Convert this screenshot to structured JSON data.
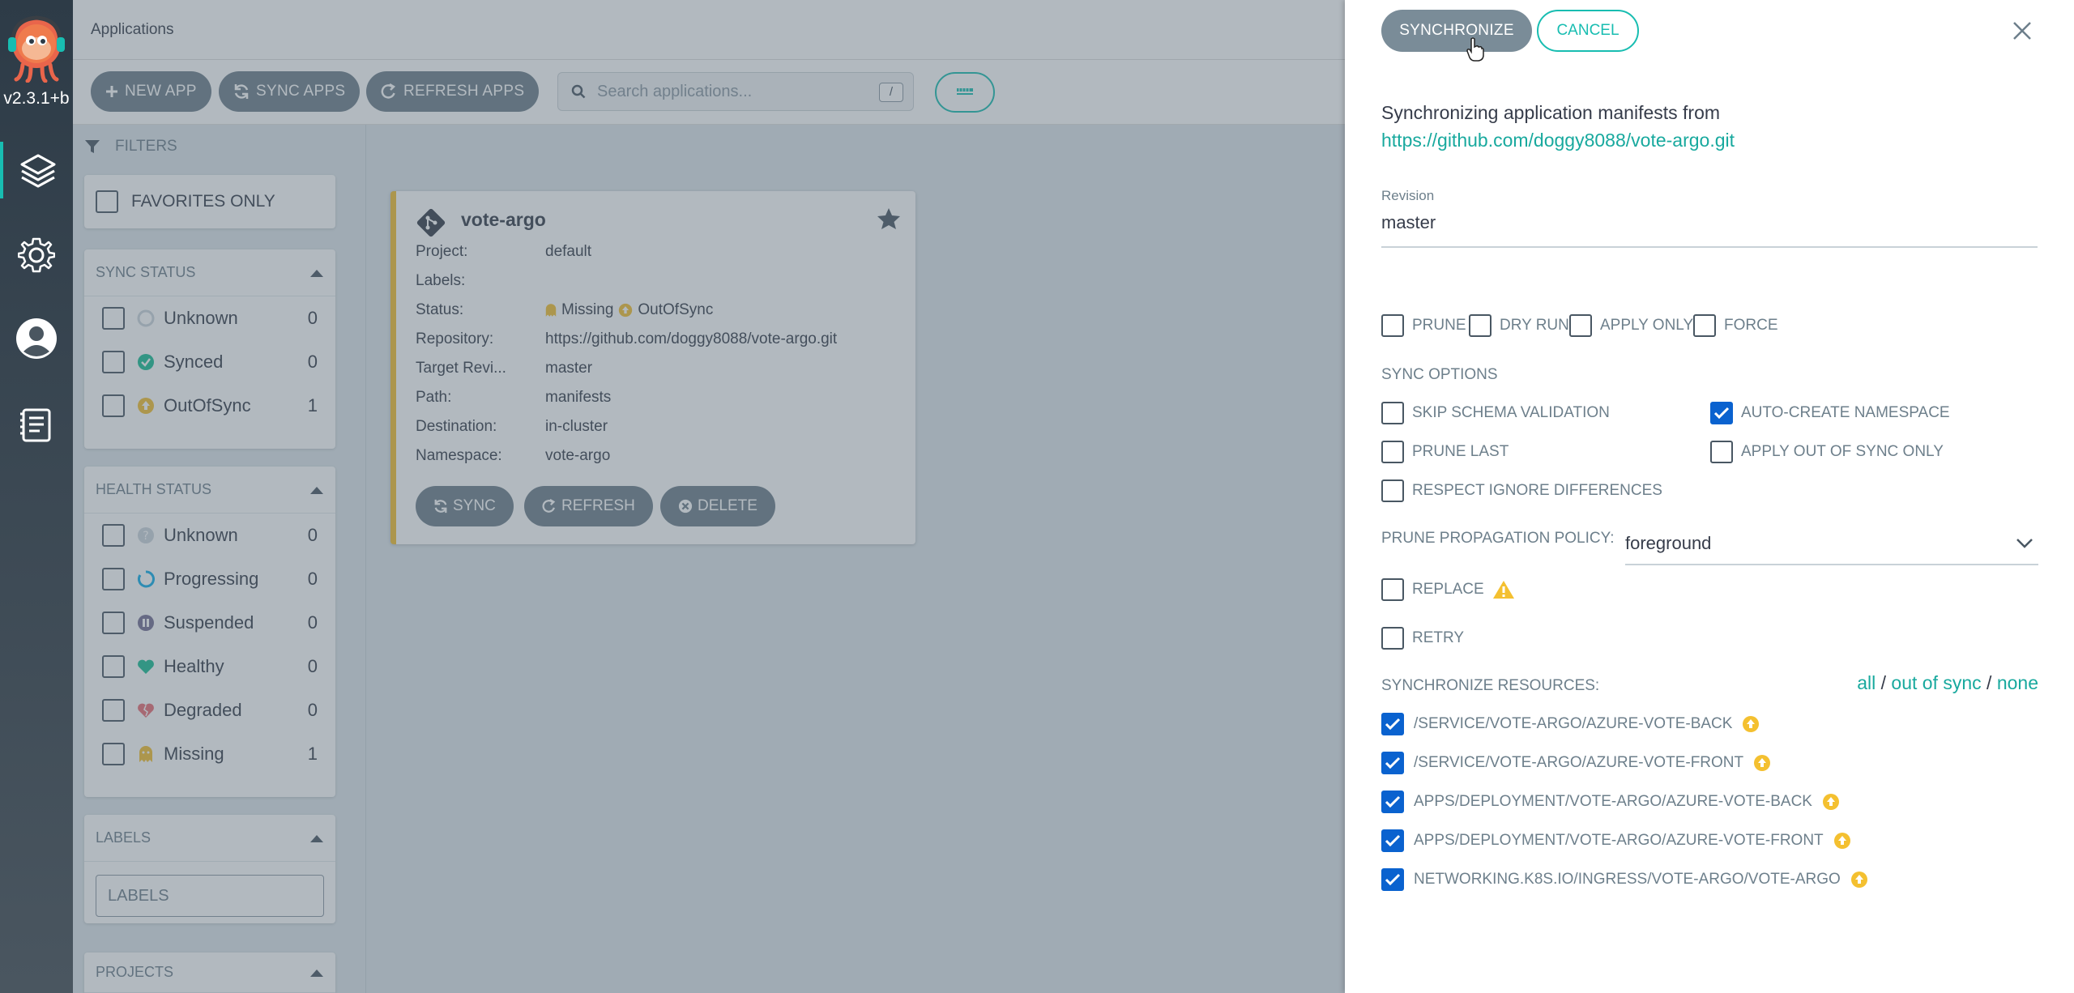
{
  "app": {
    "version": "v2.3.1+b",
    "page_title": "Applications"
  },
  "toolbar": {
    "new_app": "NEW APP",
    "sync_apps": "SYNC APPS",
    "refresh_apps": "REFRESH APPS",
    "search_placeholder": "Search applications...",
    "search_shortcut": "/"
  },
  "filters": {
    "header": "FILTERS",
    "favorites_only": "FAVORITES ONLY",
    "sync_status": {
      "title": "SYNC STATUS",
      "items": [
        {
          "label": "Unknown",
          "count": "0"
        },
        {
          "label": "Synced",
          "count": "0"
        },
        {
          "label": "OutOfSync",
          "count": "1"
        }
      ]
    },
    "health_status": {
      "title": "HEALTH STATUS",
      "items": [
        {
          "label": "Unknown",
          "count": "0"
        },
        {
          "label": "Progressing",
          "count": "0"
        },
        {
          "label": "Suspended",
          "count": "0"
        },
        {
          "label": "Healthy",
          "count": "0"
        },
        {
          "label": "Degraded",
          "count": "0"
        },
        {
          "label": "Missing",
          "count": "1"
        }
      ]
    },
    "labels": {
      "title": "LABELS",
      "placeholder": "LABELS"
    },
    "projects": {
      "title": "PROJECTS"
    }
  },
  "app_card": {
    "name": "vote-argo",
    "rows": [
      {
        "key": "Project:",
        "value": "default"
      },
      {
        "key": "Labels:",
        "value": ""
      },
      {
        "key": "Status:",
        "value": ""
      },
      {
        "key": "Repository:",
        "value": "https://github.com/doggy8088/vote-argo.git"
      },
      {
        "key": "Target Revi...",
        "value": "master"
      },
      {
        "key": "Path:",
        "value": "manifests"
      },
      {
        "key": "Destination:",
        "value": "in-cluster"
      },
      {
        "key": "Namespace:",
        "value": "vote-argo"
      }
    ],
    "status_health": "Missing",
    "status_sync": "OutOfSync",
    "buttons": {
      "sync": "SYNC",
      "refresh": "REFRESH",
      "delete": "DELETE"
    }
  },
  "panel": {
    "synchronize": "SYNCHRONIZE",
    "cancel": "CANCEL",
    "intro": "Synchronizing application manifests from",
    "repo_url": "https://github.com/doggy8088/vote-argo.git",
    "revision_label": "Revision",
    "revision": "master",
    "options": {
      "prune": "PRUNE",
      "dry_run": "DRY RUN",
      "apply_only": "APPLY ONLY",
      "force": "FORCE"
    },
    "sync_options_title": "SYNC OPTIONS",
    "sync_options": {
      "skip_schema_validation": "SKIP SCHEMA VALIDATION",
      "auto_create_namespace": "AUTO-CREATE NAMESPACE",
      "prune_last": "PRUNE LAST",
      "apply_out_of_sync_only": "APPLY OUT OF SYNC ONLY",
      "respect_ignore_differences": "RESPECT IGNORE DIFFERENCES"
    },
    "prune_policy_label": "PRUNE PROPAGATION POLICY:",
    "prune_policy_value": "foreground",
    "replace": "REPLACE",
    "retry": "RETRY",
    "resources_title": "SYNCHRONIZE RESOURCES:",
    "select_all": "all",
    "select_out_of_sync": "out of sync",
    "select_none": "none",
    "resources": [
      "/SERVICE/VOTE-ARGO/AZURE-VOTE-BACK",
      "/SERVICE/VOTE-ARGO/AZURE-VOTE-FRONT",
      "APPS/DEPLOYMENT/VOTE-ARGO/AZURE-VOTE-BACK",
      "APPS/DEPLOYMENT/VOTE-ARGO/AZURE-VOTE-FRONT",
      "NETWORKING.K8S.IO/INGRESS/VOTE-ARGO/VOTE-ARGO"
    ]
  },
  "colors": {
    "accent": "#18bdb1",
    "check_blue": "#0a62cf",
    "out_of_sync": "#f4c030",
    "healthy": "#18be94",
    "degraded": "#e96d76",
    "suspended": "#766f94",
    "progressing": "#0dadea",
    "unknown": "#ccd6dd"
  }
}
